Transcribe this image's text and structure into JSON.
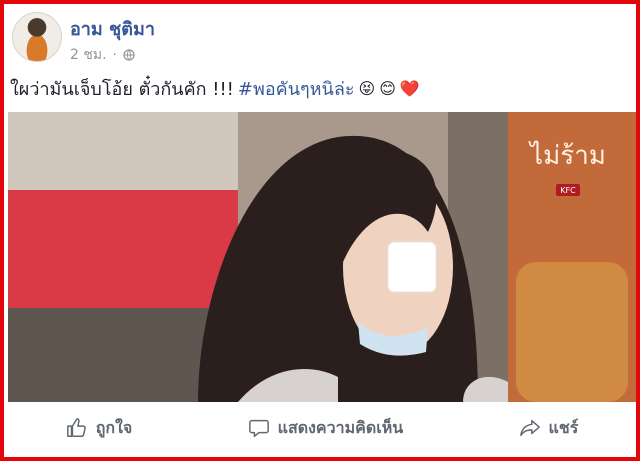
{
  "post": {
    "author": "อาม ชุติมา",
    "time": "2 ชม.",
    "privacy_icon": "globe-icon",
    "message": {
      "text": "ใผว่ามันเจ็บโอ้ย ตั๋วกันคัก !!!",
      "hashtag": "#พอคันๆหนิล่ะ",
      "emojis": [
        "😝",
        "😊",
        "❤️"
      ]
    },
    "photo": {
      "sign_text": "ไม่ร้าม",
      "brand_badge": "KFC"
    }
  },
  "actions": {
    "like": {
      "label": "ถูกใจ",
      "icon": "thumbs-up-icon"
    },
    "comment": {
      "label": "แสดงความคิดเห็น",
      "icon": "comment-icon"
    },
    "share": {
      "label": "แชร์",
      "icon": "share-icon"
    }
  },
  "colors": {
    "frame": "#e3070b",
    "link": "#365899",
    "meta": "#90949c",
    "action": "#606770"
  }
}
